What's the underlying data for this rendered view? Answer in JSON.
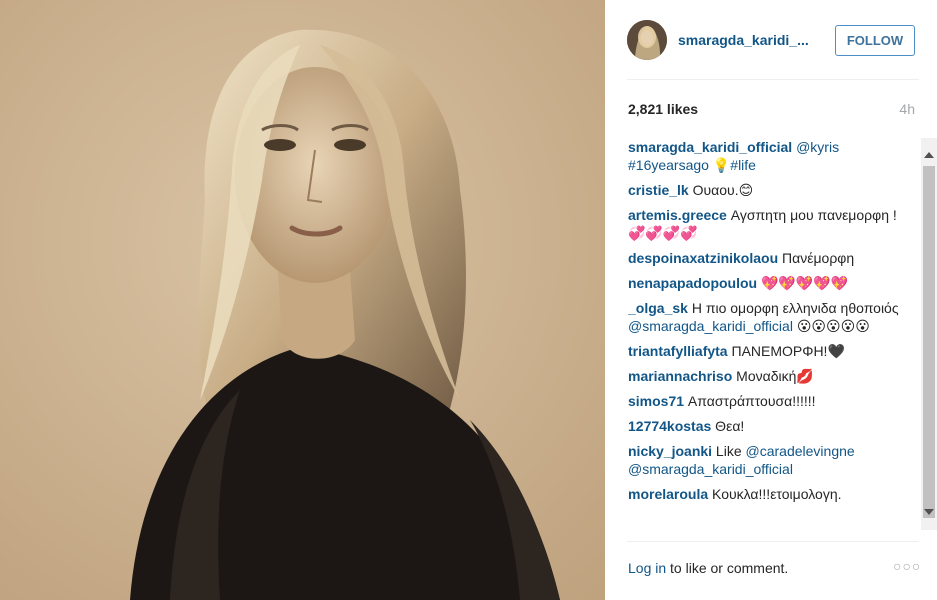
{
  "post": {
    "username": "smaragda_karidi_...",
    "follow_label": "FOLLOW",
    "likes": "2,821 likes",
    "time_ago": "4h"
  },
  "comments": [
    {
      "user": "smaragda_karidi_official",
      "text": [
        {
          "t": " "
        },
        {
          "t": "@kyris",
          "link": true
        },
        {
          "t": " "
        },
        {
          "t": "#16yearsago",
          "link": true
        },
        {
          "t": " 💡"
        },
        {
          "t": "#life",
          "link": true
        }
      ]
    },
    {
      "user": "cristie_lk",
      "text": [
        {
          "t": " Ουαου.😊"
        }
      ]
    },
    {
      "user": "artemis.greece",
      "text": [
        {
          "t": " Αγσπητη μου πανεμορφη !💞💞💞💞"
        }
      ]
    },
    {
      "user": "despoinaxatzinikolaou",
      "text": [
        {
          "t": " Πανέμορφη"
        }
      ]
    },
    {
      "user": "nenapapadopoulou",
      "text": [
        {
          "t": " 💖💖💖💖💖"
        }
      ]
    },
    {
      "user": "_olga_sk",
      "text": [
        {
          "t": " Η πιο ομορφη ελληνιδα ηθοποιός "
        },
        {
          "t": "@smaragda_karidi_official",
          "link": true
        },
        {
          "t": " 😮😮😮😮😮"
        }
      ]
    },
    {
      "user": "triantafylliafyta",
      "text": [
        {
          "t": " ΠΑΝΕΜΟΡΦΗ!🖤"
        }
      ]
    },
    {
      "user": "mariannachriso",
      "text": [
        {
          "t": " Μοναδική💋"
        }
      ]
    },
    {
      "user": "simos71",
      "text": [
        {
          "t": " Απαστράπτουσα!!!!!!"
        }
      ]
    },
    {
      "user": "12774kostas",
      "text": [
        {
          "t": " Θεα!"
        }
      ]
    },
    {
      "user": "nicky_joanki",
      "text": [
        {
          "t": " Like "
        },
        {
          "t": "@caradelevingne",
          "link": true
        },
        {
          "t": " "
        },
        {
          "t": "@smaragda_karidi_official",
          "link": true
        }
      ]
    },
    {
      "user": "morelaroula",
      "text": [
        {
          "t": " Κουκλα!!!ετοιμολογη."
        }
      ]
    }
  ],
  "footer": {
    "login_label": "Log in",
    "rest_label": " to like or comment.",
    "more_label": "○○○"
  },
  "icons": {
    "scroll_up": "scroll-up-arrow-icon",
    "scroll_down": "scroll-down-arrow-icon"
  },
  "colors": {
    "username_blue": "#125688",
    "follow_border": "#4d8ec7",
    "muted": "#a5a7aa"
  }
}
